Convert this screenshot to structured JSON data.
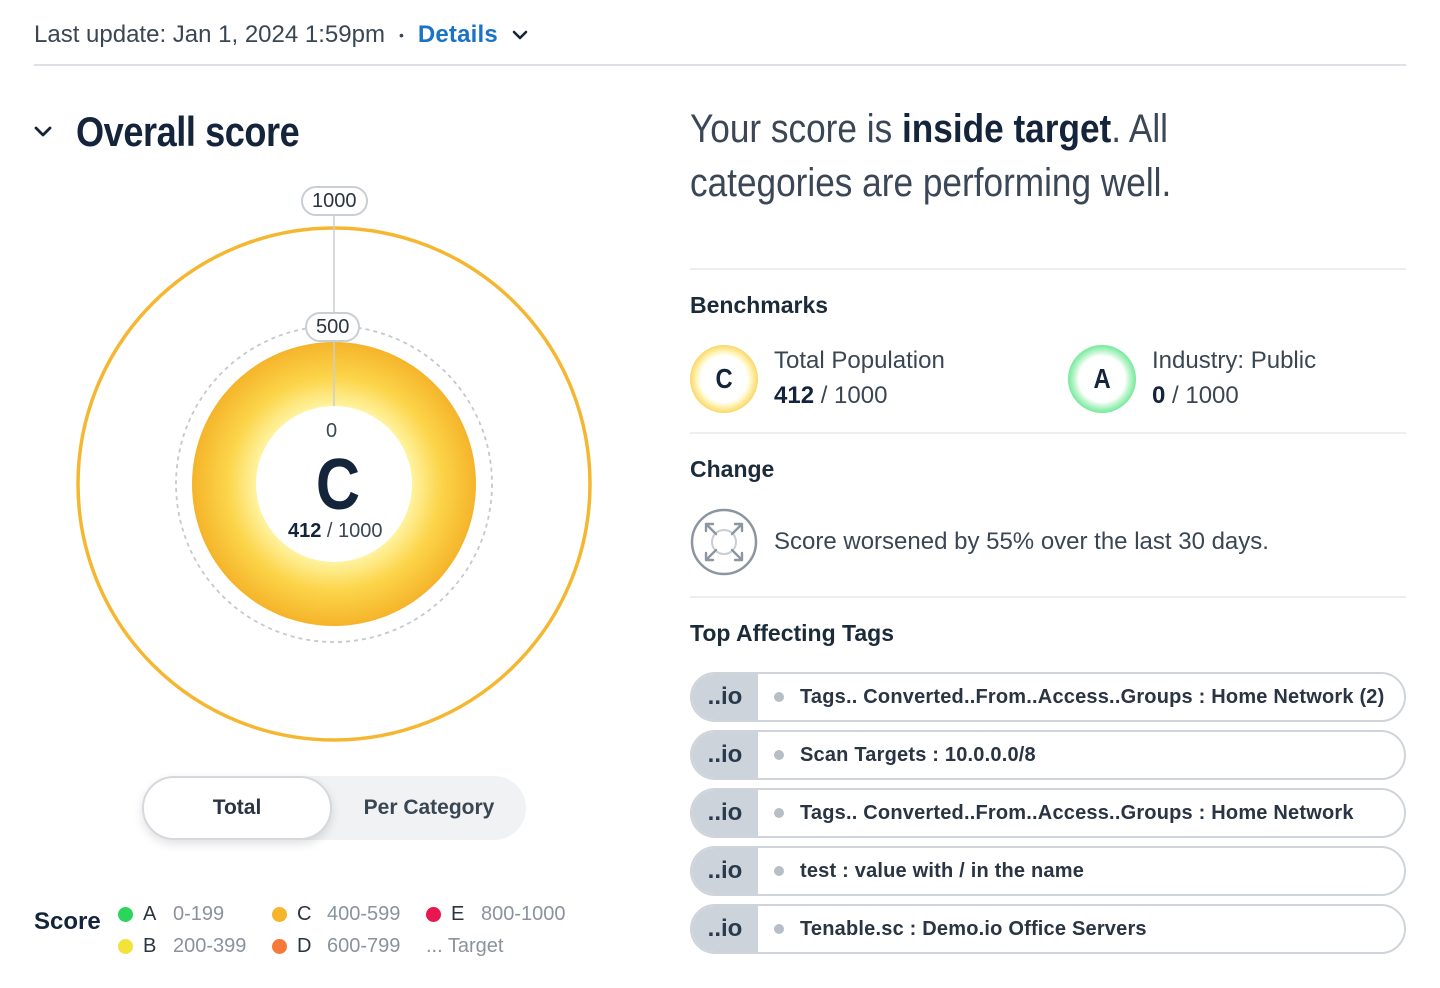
{
  "header": {
    "last_update": "Last update: Jan 1, 2024 1:59pm",
    "separator": "•",
    "details_link": "Details",
    "details_icon": "chevron-down-icon"
  },
  "overall": {
    "title": "Overall score",
    "collapse_icon": "chevron-down-icon",
    "gauge": {
      "max_label": "1000",
      "mid_label": "500",
      "zero_label": "0",
      "grade": "C",
      "score": "412",
      "score_suffix": " / 1000",
      "score_value": 412,
      "score_max": 1000
    },
    "toggle": {
      "total": "Total",
      "per_category": "Per Category",
      "selected": "Total"
    },
    "legend": {
      "label": "Score",
      "items": [
        {
          "grade": "A",
          "range": "0-199",
          "color": "#2bd45a"
        },
        {
          "grade": "B",
          "range": "200-399",
          "color": "#f2e23a"
        },
        {
          "grade": "C",
          "range": "400-599",
          "color": "#f5b42a"
        },
        {
          "grade": "D",
          "range": "600-799",
          "color": "#f57a3a"
        },
        {
          "grade": "E",
          "range": "800-1000",
          "color": "#e8174f"
        }
      ],
      "target": "... Target"
    }
  },
  "summary": {
    "prefix": "Your score is ",
    "emphasis": "inside target",
    "suffix": ". All categories are performing well."
  },
  "benchmarks": {
    "heading": "Benchmarks",
    "items": [
      {
        "grade": "C",
        "name": "Total Population",
        "score": "412",
        "max": " / 1000",
        "color": "#f5c02a"
      },
      {
        "grade": "A",
        "name": "Industry: Public",
        "score": "0",
        "max": " / 1000",
        "color": "#2bd45a"
      }
    ]
  },
  "change": {
    "heading": "Change",
    "icon": "arrows-expand-icon",
    "text": "Score worsened by 55% over the last 30 days."
  },
  "tags": {
    "heading": "Top Affecting Tags",
    "items": [
      {
        "source": "..io",
        "label": "Tags.. Converted..From..Access..Groups : Home Network (2)"
      },
      {
        "source": "..io",
        "label": "Scan Targets : 10.0.0.0/8"
      },
      {
        "source": "..io",
        "label": "Tags.. Converted..From..Access..Groups : Home Network"
      },
      {
        "source": "..io",
        "label": "test : value with / in the name"
      },
      {
        "source": "..io",
        "label": "Tenable.sc : Demo.io Office Servers"
      }
    ]
  }
}
